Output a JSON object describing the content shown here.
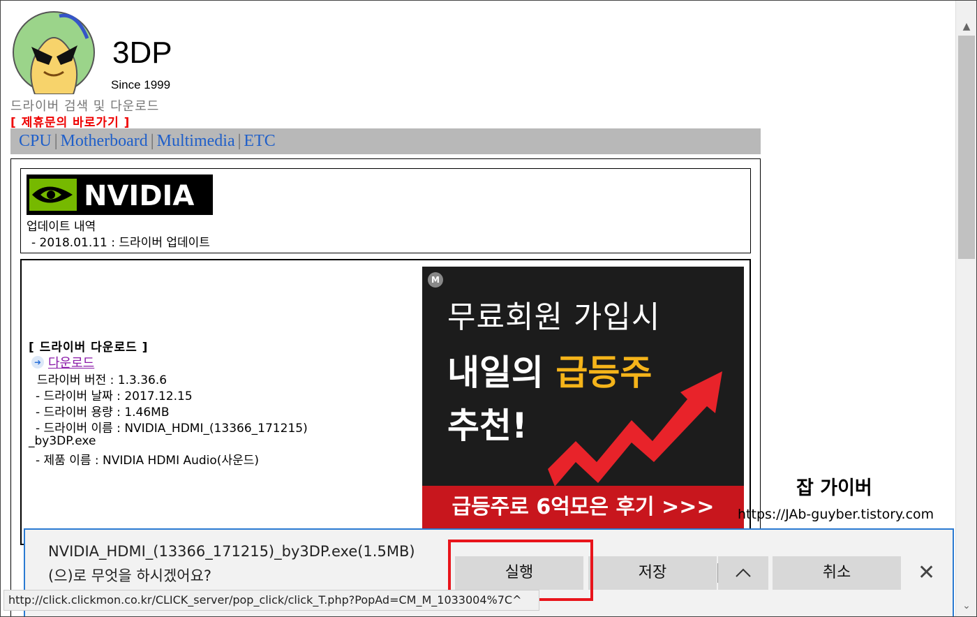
{
  "header": {
    "site_name": "3DP",
    "since": "Since 1999",
    "tagline": "드라이버 검색 및 다운로드",
    "partner_link": "[ 제휴문의 바로가기 ]"
  },
  "nav": {
    "items": [
      "CPU",
      "Motherboard",
      "Multimedia",
      "ETC"
    ],
    "separator": "|"
  },
  "info": {
    "brand": "NVIDIA",
    "update_title": "업데이트 내역",
    "update_line": "- 2018.01.11 : 드라이버 업데이트"
  },
  "download": {
    "header": "[ 드라이버 다운로드 ]",
    "link_label": "다운로드",
    "lines": [
      "드라이버 버전 : 1.3.36.6",
      "- 드라이버 날짜 : 2017.12.15",
      "- 드라이버 용량 : 1.46MB",
      "- 드라이버 이름 : NVIDIA_HDMI_(13366_171215)",
      "_by3DP.exe",
      "- 제품 이름 : NVIDIA HDMI Audio(사운드)"
    ]
  },
  "ad": {
    "badge": "M",
    "line1": "무료회원 가입시",
    "line2_a": "내일의 ",
    "line2_b": "급등주",
    "line3": "추천!",
    "banner": "급등주로 6억모은 후기 >>>"
  },
  "watermark": {
    "title": "잡 가이버",
    "url": "https://JAb-guyber.tistory.com"
  },
  "download_bar": {
    "message_line1": "NVIDIA_HDMI_(13366_171215)_by3DP.exe(1.5MB)",
    "message_line2": "(으)로 무엇을 하시겠어요?",
    "run_label": "실행",
    "save_label": "저장",
    "more_label": "^",
    "cancel_label": "취소",
    "close_label": "✕"
  },
  "status_bar": {
    "url": "http://click.clickmon.co.kr/CLICK_server/pop_click/click_T.php?PopAd=CM_M_1033004%7C^"
  },
  "colors": {
    "nav_link": "#1f5fc9",
    "partner_link": "#e00000",
    "download_link": "#8a1aa8",
    "highlight": "#e8141b",
    "ad_accent": "#f5b41a",
    "ad_banner": "#c8161d",
    "dl_bar_border": "#2a7ad2"
  }
}
